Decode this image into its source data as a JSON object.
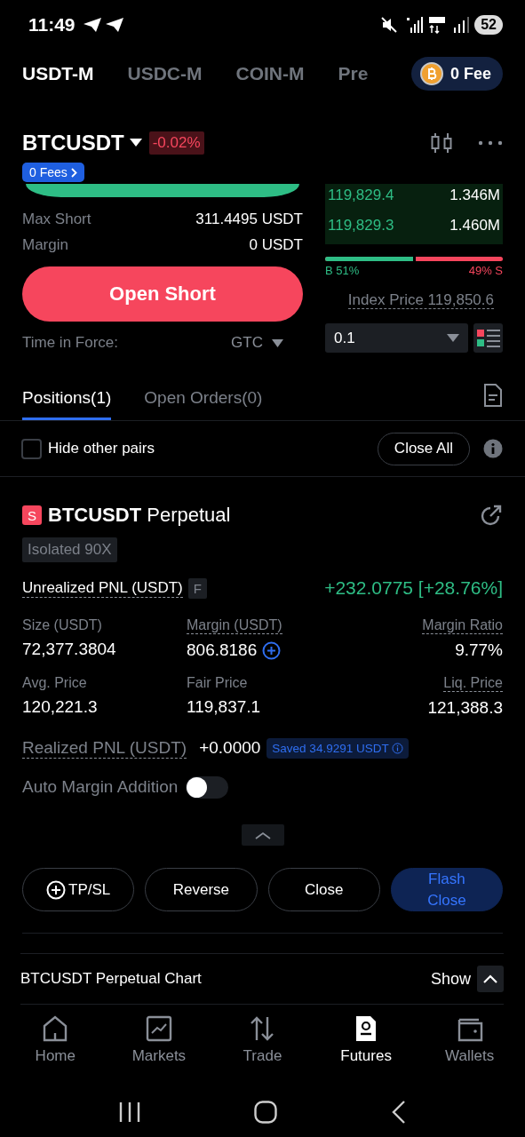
{
  "status_bar": {
    "time": "11:49",
    "battery": "52"
  },
  "market_tabs": [
    {
      "label": "USDT-M",
      "selected": true
    },
    {
      "label": "USDC-M",
      "selected": false
    },
    {
      "label": "COIN-M",
      "selected": false
    },
    {
      "label": "Pre",
      "selected": false
    }
  ],
  "fee_promo": {
    "label": "0 Fee"
  },
  "symbol": {
    "name": "BTCUSDT",
    "change": "-0.02%",
    "fees_badge": "0 Fees"
  },
  "order_form": {
    "rows": [
      {
        "label": "Max Short",
        "value": "311.4495 USDT"
      },
      {
        "label": "Margin",
        "value": "0 USDT"
      }
    ],
    "submit": "Open Short",
    "time_in_force": {
      "label": "Time in Force:",
      "value": "GTC"
    }
  },
  "order_book": {
    "rows": [
      {
        "price": "119,829.4",
        "amount": "1.346M"
      },
      {
        "price": "119,829.3",
        "amount": "1.460M"
      }
    ],
    "buy_share": {
      "level": 0.51
    },
    "buy_label": "B 51%",
    "sell_label": "49% S",
    "index_price": "Index Price 119,850.6",
    "precision": "0.1"
  },
  "position_tabs": [
    {
      "label": "Positions(1)",
      "selected": true
    },
    {
      "label": "Open Orders(0)",
      "selected": false
    }
  ],
  "filter": {
    "label": "Hide other pairs",
    "checked": false,
    "close_all": "Close All"
  },
  "position": {
    "side_badge": "S",
    "symbol": "BTCUSDT",
    "contract": "Perpetual",
    "margin_mode": "Isolated 90X",
    "unrealized_label": "Unrealized PNL (USDT)",
    "flag": "F",
    "unrealized_value": "+232.0775 [+28.76%]",
    "fields": [
      {
        "label": "Size (USDT)",
        "value": "72,377.3804",
        "dotted": false,
        "kind": "plain"
      },
      {
        "label": "Margin (USDT)",
        "value": "806.8186",
        "dotted": true,
        "kind": "add"
      },
      {
        "label": "Margin Ratio",
        "value": "9.77%",
        "dotted": true,
        "kind": "plain"
      },
      {
        "label": "Avg. Price",
        "value": "120,221.3",
        "dotted": false,
        "kind": "plain"
      },
      {
        "label": "Fair Price",
        "value": "119,837.1",
        "dotted": false,
        "kind": "plain"
      },
      {
        "label": "Liq. Price",
        "value": "121,388.3",
        "dotted": true,
        "kind": "plain"
      }
    ],
    "realized_label": "Realized PNL (USDT)",
    "realized_value": "+0.0000",
    "saved": "Saved 34.9291 USDT",
    "auto_margin": {
      "label": "Auto Margin Addition",
      "on": false
    },
    "actions": [
      {
        "label": "TP/SL",
        "kind": "add"
      },
      {
        "label": "Reverse",
        "kind": "outline"
      },
      {
        "label": "Close",
        "kind": "outline"
      },
      {
        "label": "Flash Close",
        "kind": "primary"
      }
    ]
  },
  "chart_panel": {
    "title": "BTCUSDT Perpetual Chart",
    "toggle": "Show"
  },
  "bottom_nav": [
    {
      "label": "Home",
      "kind": "home",
      "selected": false
    },
    {
      "label": "Markets",
      "kind": "markets",
      "selected": false
    },
    {
      "label": "Trade",
      "kind": "trade",
      "selected": false
    },
    {
      "label": "Futures",
      "kind": "futures",
      "selected": true
    },
    {
      "label": "Wallets",
      "kind": "wallets",
      "selected": false
    }
  ]
}
